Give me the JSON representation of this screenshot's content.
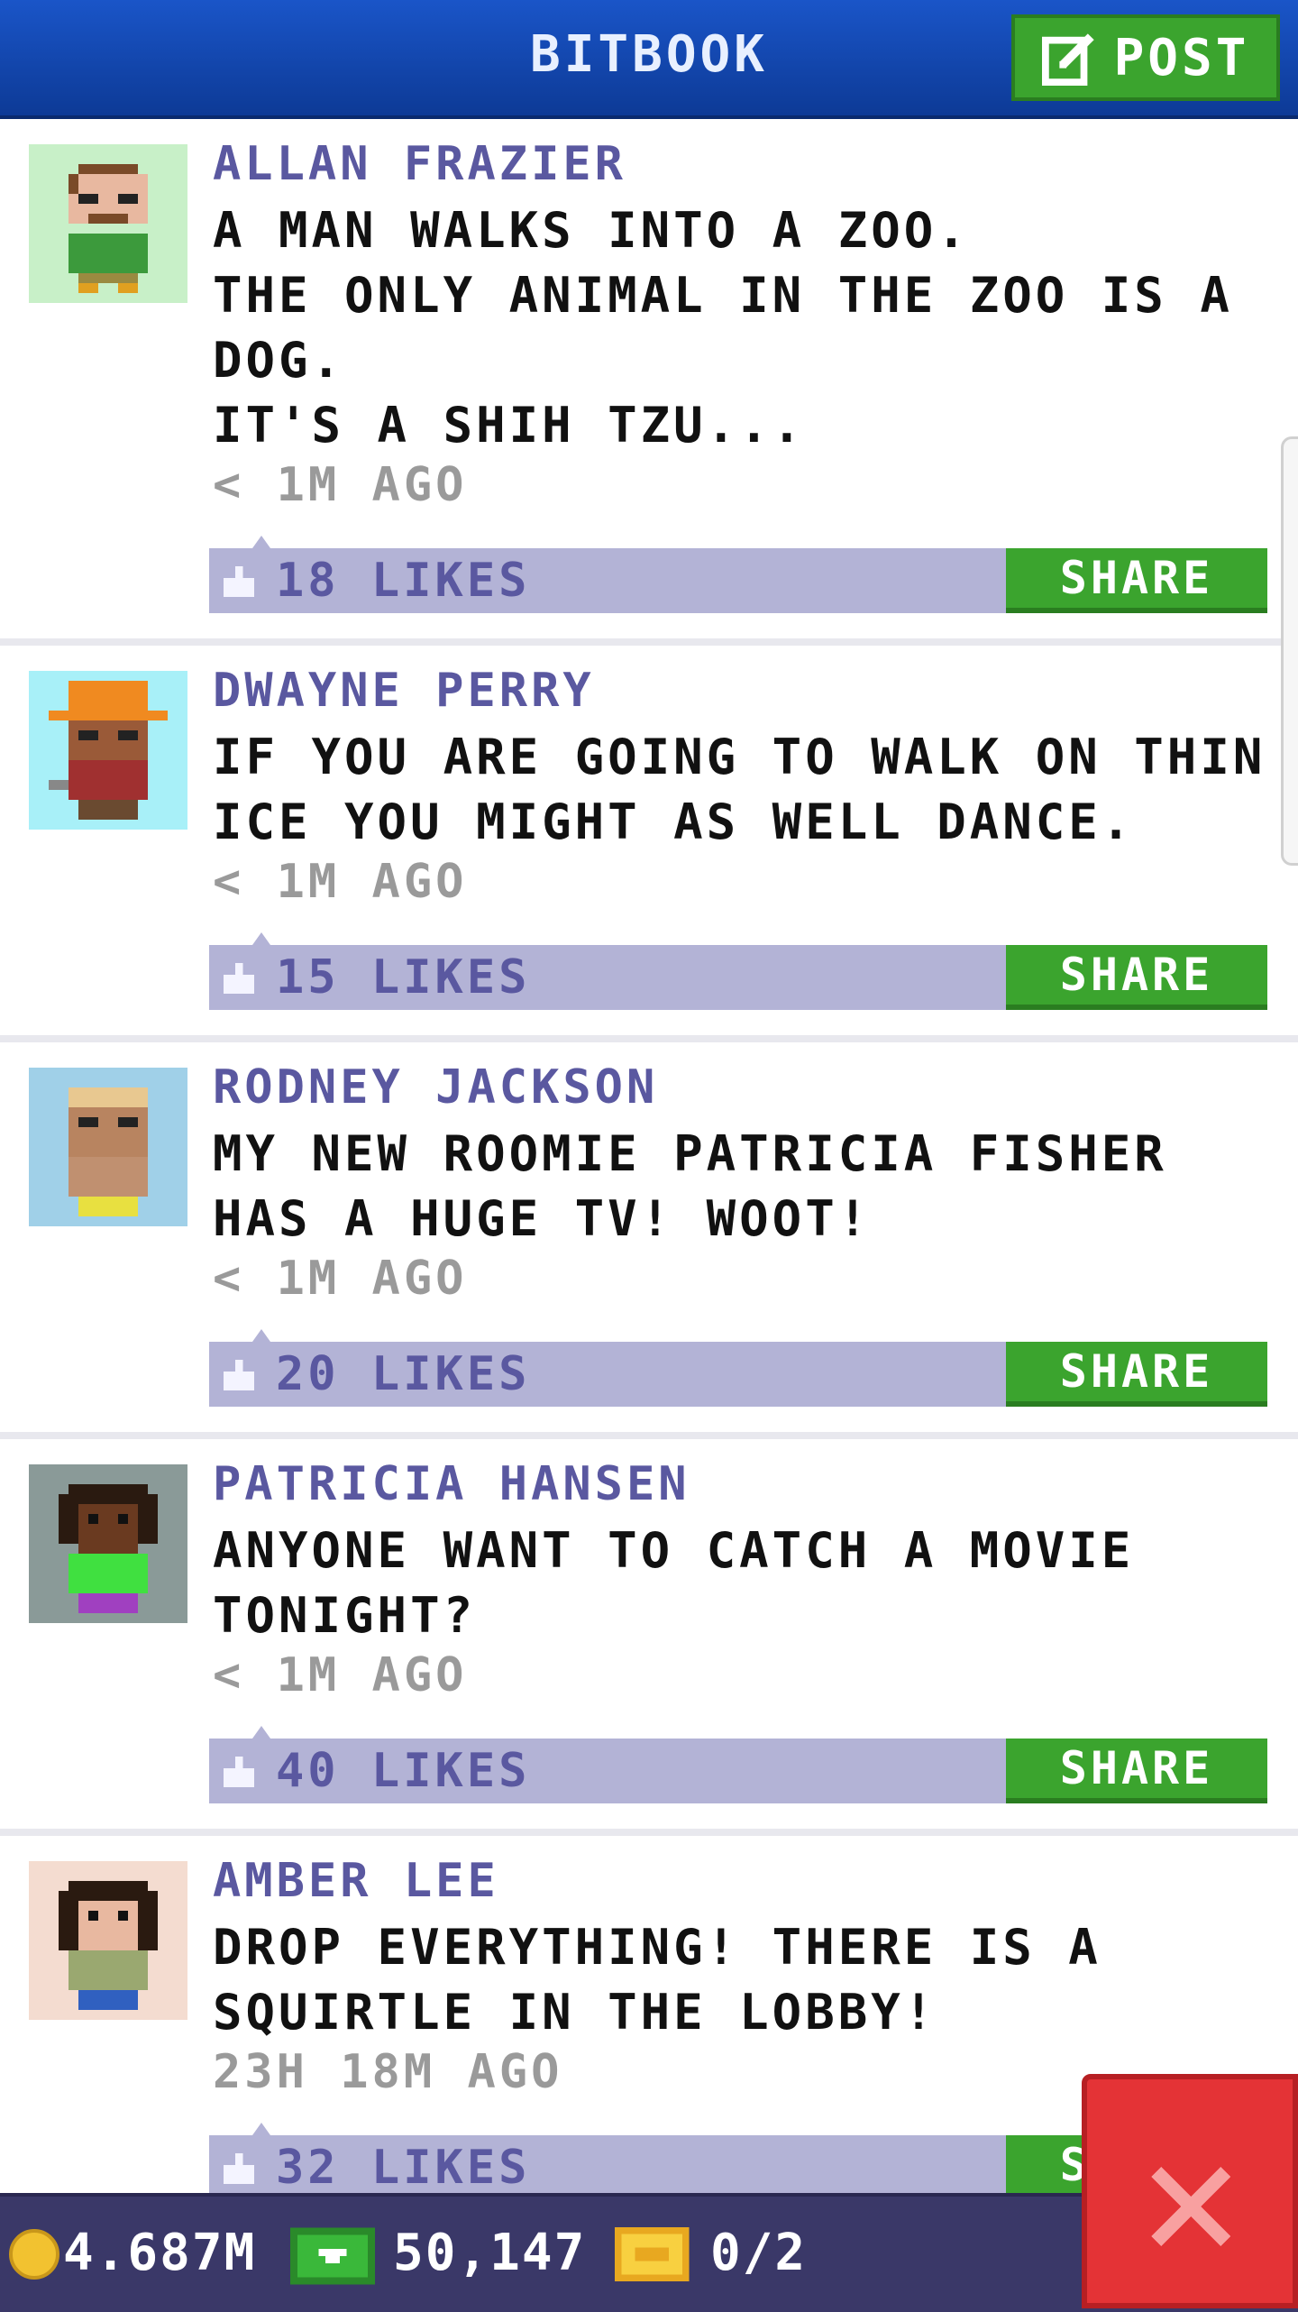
{
  "header": {
    "title": "BITBOOK",
    "post_label": "POST"
  },
  "posts": [
    {
      "author": "ALLAN FRAZIER",
      "text": "A MAN WALKS INTO A ZOO.\nTHE ONLY ANIMAL IN THE ZOO IS A DOG.\nIT'S A SHIH TZU...",
      "time": "< 1M AGO",
      "likes": "18 LIKES",
      "share": "SHARE",
      "avatar": {
        "bg": "#c8f0c8",
        "skin": "#e8b8a0",
        "hair": "#7a4a28",
        "shirt": "#3c9a3c",
        "legs": "#9a8a40",
        "hat": null,
        "glasses": true
      }
    },
    {
      "author": "DWAYNE PERRY",
      "text": "IF YOU ARE GOING TO WALK ON THIN ICE YOU MIGHT AS WELL DANCE.",
      "time": "< 1M AGO",
      "likes": "15 LIKES",
      "share": "SHARE",
      "avatar": {
        "bg": "#a8f0f8",
        "skin": "#9a5a38",
        "hair": "#4a2a18",
        "shirt": "#a03030",
        "legs": "#6a4a30",
        "hat": "#f08a20",
        "glasses": false
      }
    },
    {
      "author": "RODNEY JACKSON",
      "text": "MY NEW ROOMIE PATRICIA FISHER HAS A HUGE TV! WOOT!",
      "time": "< 1M AGO",
      "likes": "20 LIKES",
      "share": "SHARE",
      "avatar": {
        "bg": "#a0d0e8",
        "skin": "#b88460",
        "hair": "#e8c890",
        "shirt": "#c09070",
        "legs": "#e8e040",
        "hat": null,
        "glasses": false
      }
    },
    {
      "author": "PATRICIA HANSEN",
      "text": "ANYONE WANT TO CATCH A MOVIE TONIGHT?",
      "time": "< 1M AGO",
      "likes": "40 LIKES",
      "share": "SHARE",
      "avatar": {
        "bg": "#8a9a98",
        "skin": "#6a3a20",
        "hair": "#2a1a10",
        "shirt": "#40e040",
        "legs": "#a040c0",
        "hat": null,
        "glasses": false
      }
    },
    {
      "author": "AMBER LEE",
      "text": "DROP EVERYTHING! THERE IS A SQUIRTLE IN THE LOBBY!",
      "time": "23H 18M AGO",
      "likes": "32 LIKES",
      "share": "SHARE",
      "avatar": {
        "bg": "#f4dcd0",
        "skin": "#e8b8a0",
        "hair": "#2a1a10",
        "shirt": "#9aa870",
        "legs": "#3060c0",
        "hat": null,
        "glasses": false
      }
    }
  ],
  "bottom_bar": {
    "coins": "4.687M",
    "bux": "50,147",
    "tickets": "0/2"
  },
  "colors": {
    "header": "#1a55c8",
    "accent_green": "#3ba42e",
    "like_bar": "#b3b3d6",
    "author": "#5a58a0",
    "bottom_bar": "#3a3868",
    "close": "#e43336"
  }
}
